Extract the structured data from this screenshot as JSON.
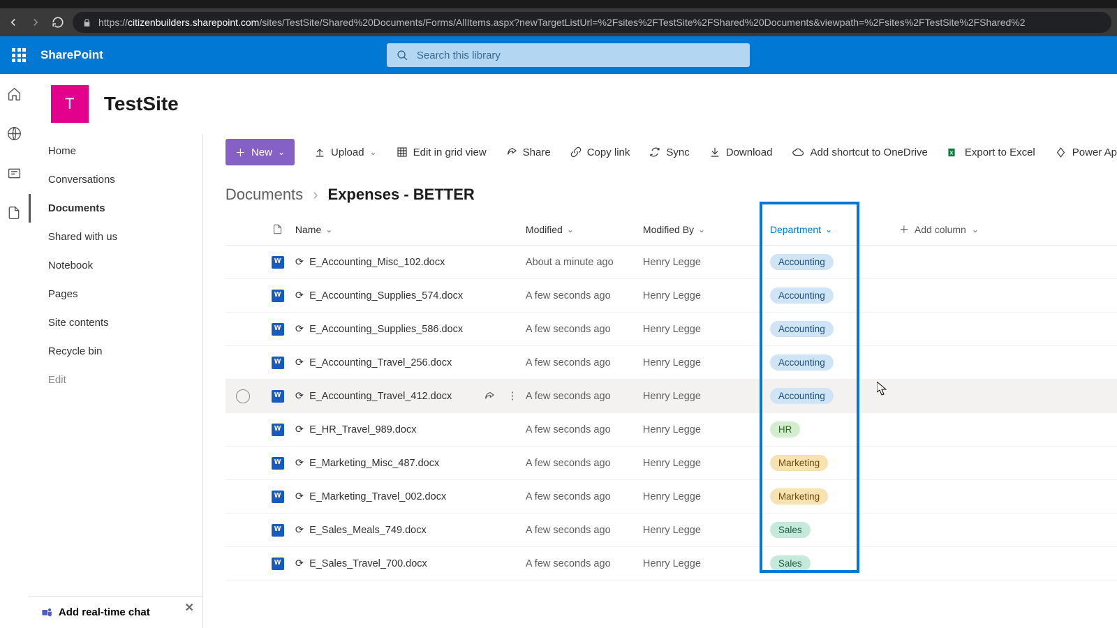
{
  "browser": {
    "url_prefix": "https://",
    "url_host": "citizenbuilders.sharepoint.com",
    "url_path": "/sites/TestSite/Shared%20Documents/Forms/AllItems.aspx?newTargetListUrl=%2Fsites%2FTestSite%2FShared%20Documents&viewpath=%2Fsites%2FTestSite%2FShared%2"
  },
  "suite": {
    "brand": "SharePoint",
    "search_placeholder": "Search this library"
  },
  "site": {
    "logo_letter": "T",
    "title": "TestSite"
  },
  "leftnav": {
    "items": [
      "Home",
      "Conversations",
      "Documents",
      "Shared with us",
      "Notebook",
      "Pages",
      "Site contents",
      "Recycle bin",
      "Edit"
    ],
    "chat_promo": "Add real-time chat"
  },
  "cmdbar": {
    "new": "New",
    "upload": "Upload",
    "edit_grid": "Edit in grid view",
    "share": "Share",
    "copylink": "Copy link",
    "sync": "Sync",
    "download": "Download",
    "shortcut": "Add shortcut to OneDrive",
    "export": "Export to Excel",
    "powerapps": "Power Ap"
  },
  "breadcrumb": {
    "root": "Documents",
    "leaf": "Expenses - BETTER"
  },
  "table": {
    "columns": {
      "name": "Name",
      "modified": "Modified",
      "modifiedby": "Modified By",
      "department": "Department",
      "add": "Add column"
    },
    "rows": [
      {
        "name": "E_Accounting_Misc_102.docx",
        "modified": "About a minute ago",
        "by": "Henry Legge",
        "dept": "Accounting",
        "dept_class": "acct"
      },
      {
        "name": "E_Accounting_Supplies_574.docx",
        "modified": "A few seconds ago",
        "by": "Henry Legge",
        "dept": "Accounting",
        "dept_class": "acct"
      },
      {
        "name": "E_Accounting_Supplies_586.docx",
        "modified": "A few seconds ago",
        "by": "Henry Legge",
        "dept": "Accounting",
        "dept_class": "acct"
      },
      {
        "name": "E_Accounting_Travel_256.docx",
        "modified": "A few seconds ago",
        "by": "Henry Legge",
        "dept": "Accounting",
        "dept_class": "acct"
      },
      {
        "name": "E_Accounting_Travel_412.docx",
        "modified": "A few seconds ago",
        "by": "Henry Legge",
        "dept": "Accounting",
        "dept_class": "acct",
        "hover": true
      },
      {
        "name": "E_HR_Travel_989.docx",
        "modified": "A few seconds ago",
        "by": "Henry Legge",
        "dept": "HR",
        "dept_class": "hr"
      },
      {
        "name": "E_Marketing_Misc_487.docx",
        "modified": "A few seconds ago",
        "by": "Henry Legge",
        "dept": "Marketing",
        "dept_class": "mkt"
      },
      {
        "name": "E_Marketing_Travel_002.docx",
        "modified": "A few seconds ago",
        "by": "Henry Legge",
        "dept": "Marketing",
        "dept_class": "mkt"
      },
      {
        "name": "E_Sales_Meals_749.docx",
        "modified": "A few seconds ago",
        "by": "Henry Legge",
        "dept": "Sales",
        "dept_class": "sal"
      },
      {
        "name": "E_Sales_Travel_700.docx",
        "modified": "A few seconds ago",
        "by": "Henry Legge",
        "dept": "Sales",
        "dept_class": "sal"
      }
    ]
  }
}
